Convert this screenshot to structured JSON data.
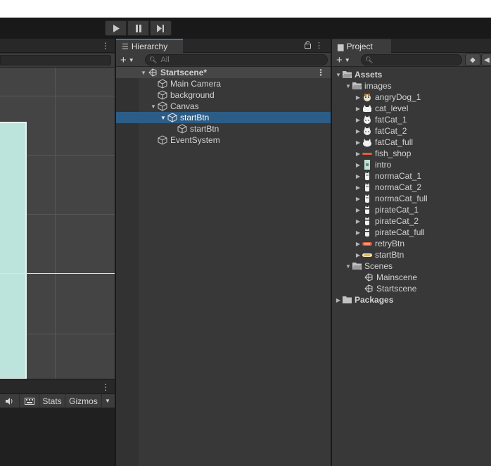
{
  "toolbar": {
    "play_icon": "play-icon",
    "pause_icon": "pause-icon",
    "step_icon": "step-icon"
  },
  "game": {
    "stats_label": "Stats",
    "gizmos_label": "Gizmos"
  },
  "hierarchy": {
    "tab_label": "Hierarchy",
    "search_placeholder": "All",
    "scene": "Startscene*",
    "items": [
      {
        "label": "Main Camera"
      },
      {
        "label": "background"
      },
      {
        "label": "Canvas"
      },
      {
        "label": "startBtn"
      },
      {
        "label": "startBtn"
      },
      {
        "label": "EventSystem"
      }
    ]
  },
  "project": {
    "tab_label": "Project",
    "assets_label": "Assets",
    "images_label": "images",
    "images": [
      {
        "label": "angryDog_1"
      },
      {
        "label": "cat_level"
      },
      {
        "label": "fatCat_1"
      },
      {
        "label": "fatCat_2"
      },
      {
        "label": "fatCat_full"
      },
      {
        "label": "fish_shop"
      },
      {
        "label": "intro"
      },
      {
        "label": "normaCat_1"
      },
      {
        "label": "normaCat_2"
      },
      {
        "label": "normaCat_full"
      },
      {
        "label": "pirateCat_1"
      },
      {
        "label": "pirateCat_2"
      },
      {
        "label": "pirateCat_full"
      },
      {
        "label": "retryBtn"
      },
      {
        "label": "startBtn"
      }
    ],
    "scenes_label": "Scenes",
    "scenes": [
      {
        "label": "Mainscene"
      },
      {
        "label": "Startscene"
      }
    ],
    "packages_label": "Packages"
  },
  "colors": {
    "selection": "#2c5d87",
    "active_tab_accent": "#3a79bb",
    "canvas_fill": "#bde4dc"
  }
}
